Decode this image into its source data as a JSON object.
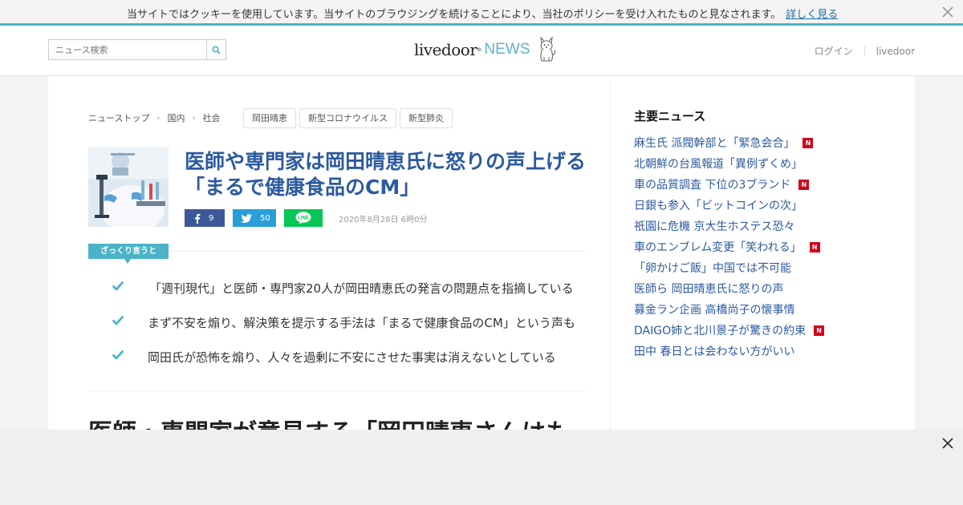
{
  "cookie_bar": {
    "text": "当サイトではクッキーを使用しています。当サイトのブラウジングを続けることにより、当社のポリシーを受け入れたものと見なされます。",
    "link": "詳しく見る"
  },
  "header": {
    "search_placeholder": "ニュース検索",
    "logo_livedoor": "livedoor",
    "logo_reg": "®",
    "logo_news": "NEWS",
    "login": "ログイン",
    "livedoor_link": "livedoor"
  },
  "breadcrumb": [
    "ニューストップ",
    "国内",
    "社会"
  ],
  "tags": [
    "岡田晴恵",
    "新型コロナウイルス",
    "新型肺炎"
  ],
  "article": {
    "headline": "医師や専門家は岡田晴恵氏に怒りの声上げる「まるで健康食品のCM」",
    "fb_count": "9",
    "tw_count": "50",
    "line_label": "LINE",
    "date": "2020年8月28日 6時0分",
    "summary_label": "ざっくり言うと",
    "summary": [
      "「週刊現代」と医師・専門家20人が岡田晴恵氏の発言の問題点を指摘している",
      "まず不安を煽り、解決策を提示する手法は「まるで健康食品のCM」という声も",
      "岡田氏が恐怖を煽り、人々を過剰に不安にさせた事実は消えないとしている"
    ],
    "body_heading": "医師・専門家が意見する「岡田晴恵さんはも"
  },
  "sidebar": {
    "title": "主要ニュース",
    "items": [
      {
        "label": "麻生氏 派閥幹部と「緊急会合」",
        "new": true
      },
      {
        "label": "北朝鮮の台風報道「異例ずくめ」",
        "new": false
      },
      {
        "label": "車の品質調査 下位の3ブランド",
        "new": true
      },
      {
        "label": "日銀も参入「ビットコインの次」",
        "new": false
      },
      {
        "label": "祇園に危機 京大生ホステス恐々",
        "new": false
      },
      {
        "label": "車のエンブレム変更「笑われる」",
        "new": true
      },
      {
        "label": "「卵かけご飯」中国では不可能",
        "new": false
      },
      {
        "label": "医師ら 岡田晴恵氏に怒りの声",
        "new": false
      },
      {
        "label": "募金ラン企画 高橋尚子の懐事情",
        "new": false
      },
      {
        "label": "DAIGO姉と北川景子が驚きの約束",
        "new": true
      },
      {
        "label": "田中 春日とは会わない方がいい",
        "new": false
      }
    ],
    "new_badge": "N"
  },
  "colors": {
    "accent": "#4ab3c8",
    "link": "#2c5aa0",
    "facebook": "#3b5998",
    "twitter": "#2a9ed8",
    "line": "#06c755",
    "new_badge": "#d0021b"
  }
}
